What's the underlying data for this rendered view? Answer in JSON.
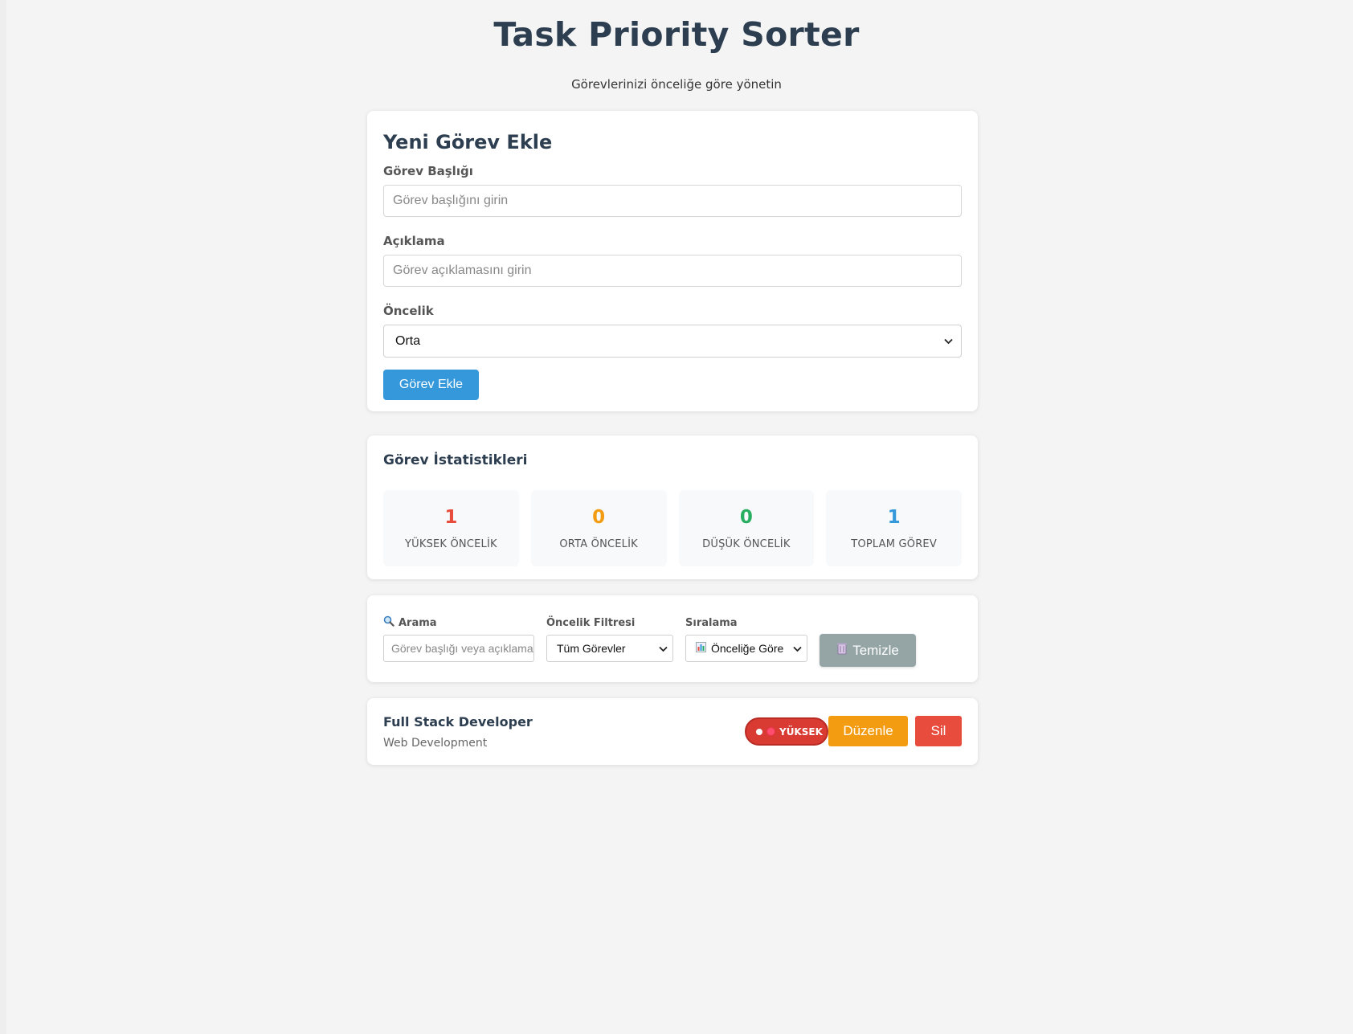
{
  "header": {
    "title": "Task Priority Sorter",
    "subtitle": "Görevlerinizi önceliğe göre yönetin"
  },
  "form": {
    "heading": "Yeni Görev Ekle",
    "title_label": "Görev Başlığı",
    "title_placeholder": "Görev başlığını girin",
    "description_label": "Açıklama",
    "description_placeholder": "Görev açıklamasını girin",
    "priority_label": "Öncelik",
    "priority_selected": "Orta",
    "submit_label": "Görev Ekle"
  },
  "stats": {
    "heading": "Görev İstatistikleri",
    "items": [
      {
        "value": "1",
        "label": "YÜKSEK ÖNCELİK",
        "color": "#e74c3c"
      },
      {
        "value": "0",
        "label": "ORTA ÖNCELİK",
        "color": "#f39c12"
      },
      {
        "value": "0",
        "label": "DÜŞÜK ÖNCELİK",
        "color": "#27ae60"
      },
      {
        "value": "1",
        "label": "TOPLAM GÖREV",
        "color": "#3498db"
      }
    ]
  },
  "filters": {
    "search_label": "Arama",
    "search_icon": "magnifier-icon",
    "search_placeholder": "Görev başlığı veya açıklama",
    "priority_filter_label": "Öncelik Filtresi",
    "priority_filter_selected": "Tüm Görevler",
    "sort_label": "Sıralama",
    "sort_icon": "bar-chart-icon",
    "sort_selected": "Önceliğe Göre",
    "clear_label": "Temizle",
    "clear_icon": "trash-icon"
  },
  "tasks": [
    {
      "title": "Full Stack Developer",
      "description": "Web Development",
      "priority_badge": "YÜKSEK",
      "edit_label": "Düzenle",
      "delete_label": "Sil"
    }
  ],
  "colors": {
    "primary": "#3498db",
    "edit": "#f39c12",
    "delete": "#e74c3c",
    "clear": "#95a5a6",
    "heading": "#2c3e50"
  }
}
